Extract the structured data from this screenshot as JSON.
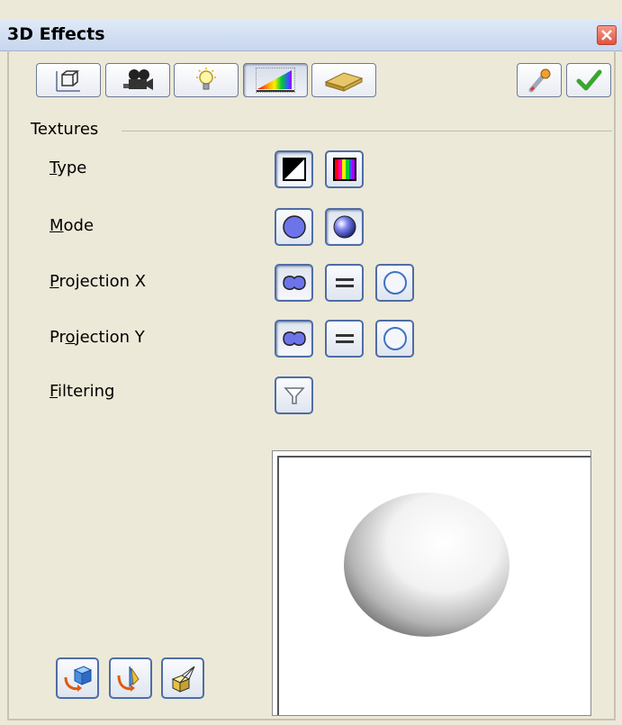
{
  "window": {
    "title": "3D Effects"
  },
  "toolbar": {
    "tabs": [
      {
        "name": "geometry",
        "icon": "cube-wireframe-icon",
        "active": false
      },
      {
        "name": "shading",
        "icon": "camera-icon",
        "active": false
      },
      {
        "name": "illumination",
        "icon": "light-bulb-icon",
        "active": false
      },
      {
        "name": "textures",
        "icon": "gradient-texture-icon",
        "active": true
      },
      {
        "name": "material",
        "icon": "material-slab-icon",
        "active": false
      }
    ],
    "right_buttons": [
      {
        "name": "assign",
        "icon": "eyedropper-icon"
      },
      {
        "name": "apply",
        "icon": "checkmark-icon"
      }
    ]
  },
  "textures": {
    "section_label": "Textures",
    "rows": [
      {
        "key": "type",
        "label_prefix": "",
        "label_mnemonic": "T",
        "label_rest": "ype",
        "options": [
          "black-white-icon",
          "color-icon"
        ]
      },
      {
        "key": "mode",
        "label_prefix": "",
        "label_mnemonic": "M",
        "label_rest": "ode",
        "options": [
          "texture-only-icon",
          "texture-shading-icon"
        ]
      },
      {
        "key": "projection_x",
        "label_prefix": "",
        "label_mnemonic": "P",
        "label_rest": "rojection X",
        "options": [
          "object-specific-icon",
          "parallel-icon",
          "circular-icon"
        ]
      },
      {
        "key": "projection_y",
        "label_prefix": "Pr",
        "label_mnemonic": "o",
        "label_rest": "jection Y",
        "options": [
          "object-specific-icon",
          "parallel-icon",
          "circular-icon"
        ]
      },
      {
        "key": "filtering",
        "label_prefix": "",
        "label_mnemonic": "F",
        "label_rest": "iltering",
        "options": [
          "filter-funnel-icon"
        ]
      }
    ]
  },
  "preview": {
    "shape": "sphere"
  },
  "bottom_buttons": [
    {
      "name": "convert-to-3d",
      "icon": "convert-3d-icon"
    },
    {
      "name": "convert-to-rotation-object",
      "icon": "rotation-object-icon"
    },
    {
      "name": "perspective",
      "icon": "perspective-icon"
    }
  ],
  "colors": {
    "accent": "#4e6da6",
    "dialog_bg": "#ece9d8",
    "close_red": "#e0543e"
  }
}
